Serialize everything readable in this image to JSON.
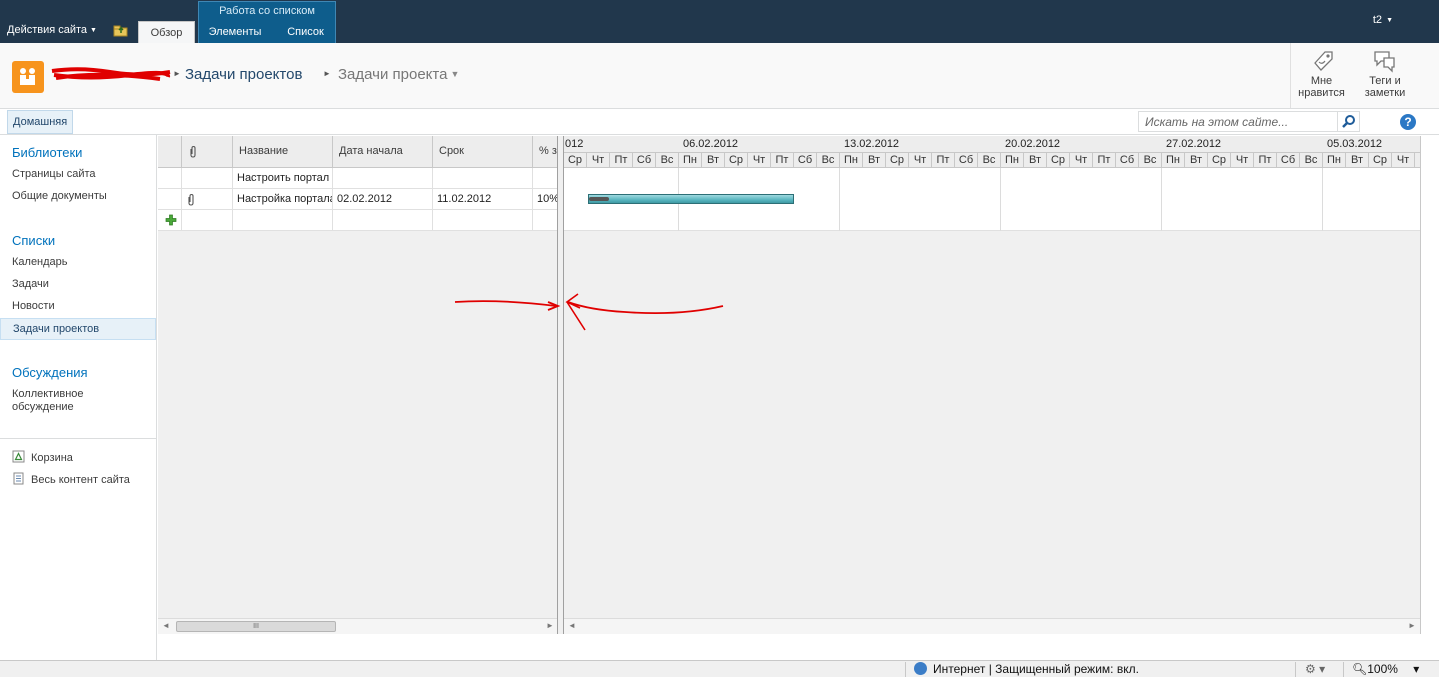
{
  "ribbon": {
    "site_actions": "Действия сайта",
    "browse_tab": "Обзор",
    "context_group": "Работа со списком",
    "items_tab": "Элементы",
    "list_tab": "Список",
    "user": "t2"
  },
  "title": {
    "breadcrumb_list": "Задачи проектов",
    "breadcrumb_page": "Задачи проекта",
    "like_label_1": "Мне",
    "like_label_2": "нравится",
    "tags_label_1": "Теги и",
    "tags_label_2": "заметки"
  },
  "topnav": {
    "home": "Домашняя",
    "search_placeholder": "Искать на этом сайте...",
    "help": "?"
  },
  "leftnav": {
    "libraries_header": "Библиотеки",
    "libraries": [
      "Страницы сайта",
      "Общие документы"
    ],
    "lists_header": "Списки",
    "lists": [
      "Календарь",
      "Задачи",
      "Новости",
      "Задачи проектов"
    ],
    "discussions_header": "Обсуждения",
    "discussions": [
      "Коллективное",
      "обсуждение"
    ],
    "recycle_bin": "Корзина",
    "all_content": "Весь контент сайта"
  },
  "grid": {
    "columns": [
      "Название",
      "Дата начала",
      "Срок",
      "% з"
    ],
    "rows": [
      {
        "title": "Настроить портал",
        "start": "",
        "due": "",
        "pct": "",
        "attachment": false
      },
      {
        "title": "Настройка портала",
        "start": "02.02.2012",
        "due": "11.02.2012",
        "pct": "10%",
        "attachment": true
      }
    ],
    "scroll_thumb": "III"
  },
  "gantt": {
    "weeks": [
      "012",
      "06.02.2012",
      "13.02.2012",
      "20.02.2012",
      "27.02.2012",
      "05.03.2012"
    ],
    "days": [
      "Ср",
      "Чт",
      "Пт",
      "Сб",
      "Вс",
      "Пн",
      "Вт",
      "Ср",
      "Чт",
      "Пт",
      "Сб",
      "Вс",
      "Пн",
      "Вт",
      "Ср",
      "Чт",
      "Пт",
      "Сб",
      "Вс",
      "Пн",
      "Вт",
      "Ср",
      "Чт",
      "Пт",
      "Сб",
      "Вс",
      "Пн",
      "Вт",
      "Ср",
      "Чт",
      "Пт",
      "Сб",
      "Вс",
      "Пн",
      "Вт",
      "Ср",
      "Чт"
    ]
  },
  "status": {
    "zone": "Интернет | Защищенный режим: вкл.",
    "zoom": "100%"
  },
  "colors": {
    "ribbon_bg": "#21374c",
    "context_tab": "#0e5d8c",
    "link_blue": "#0072bc",
    "gantt_bar": "#59b6c0",
    "annotation": "#e00000"
  }
}
